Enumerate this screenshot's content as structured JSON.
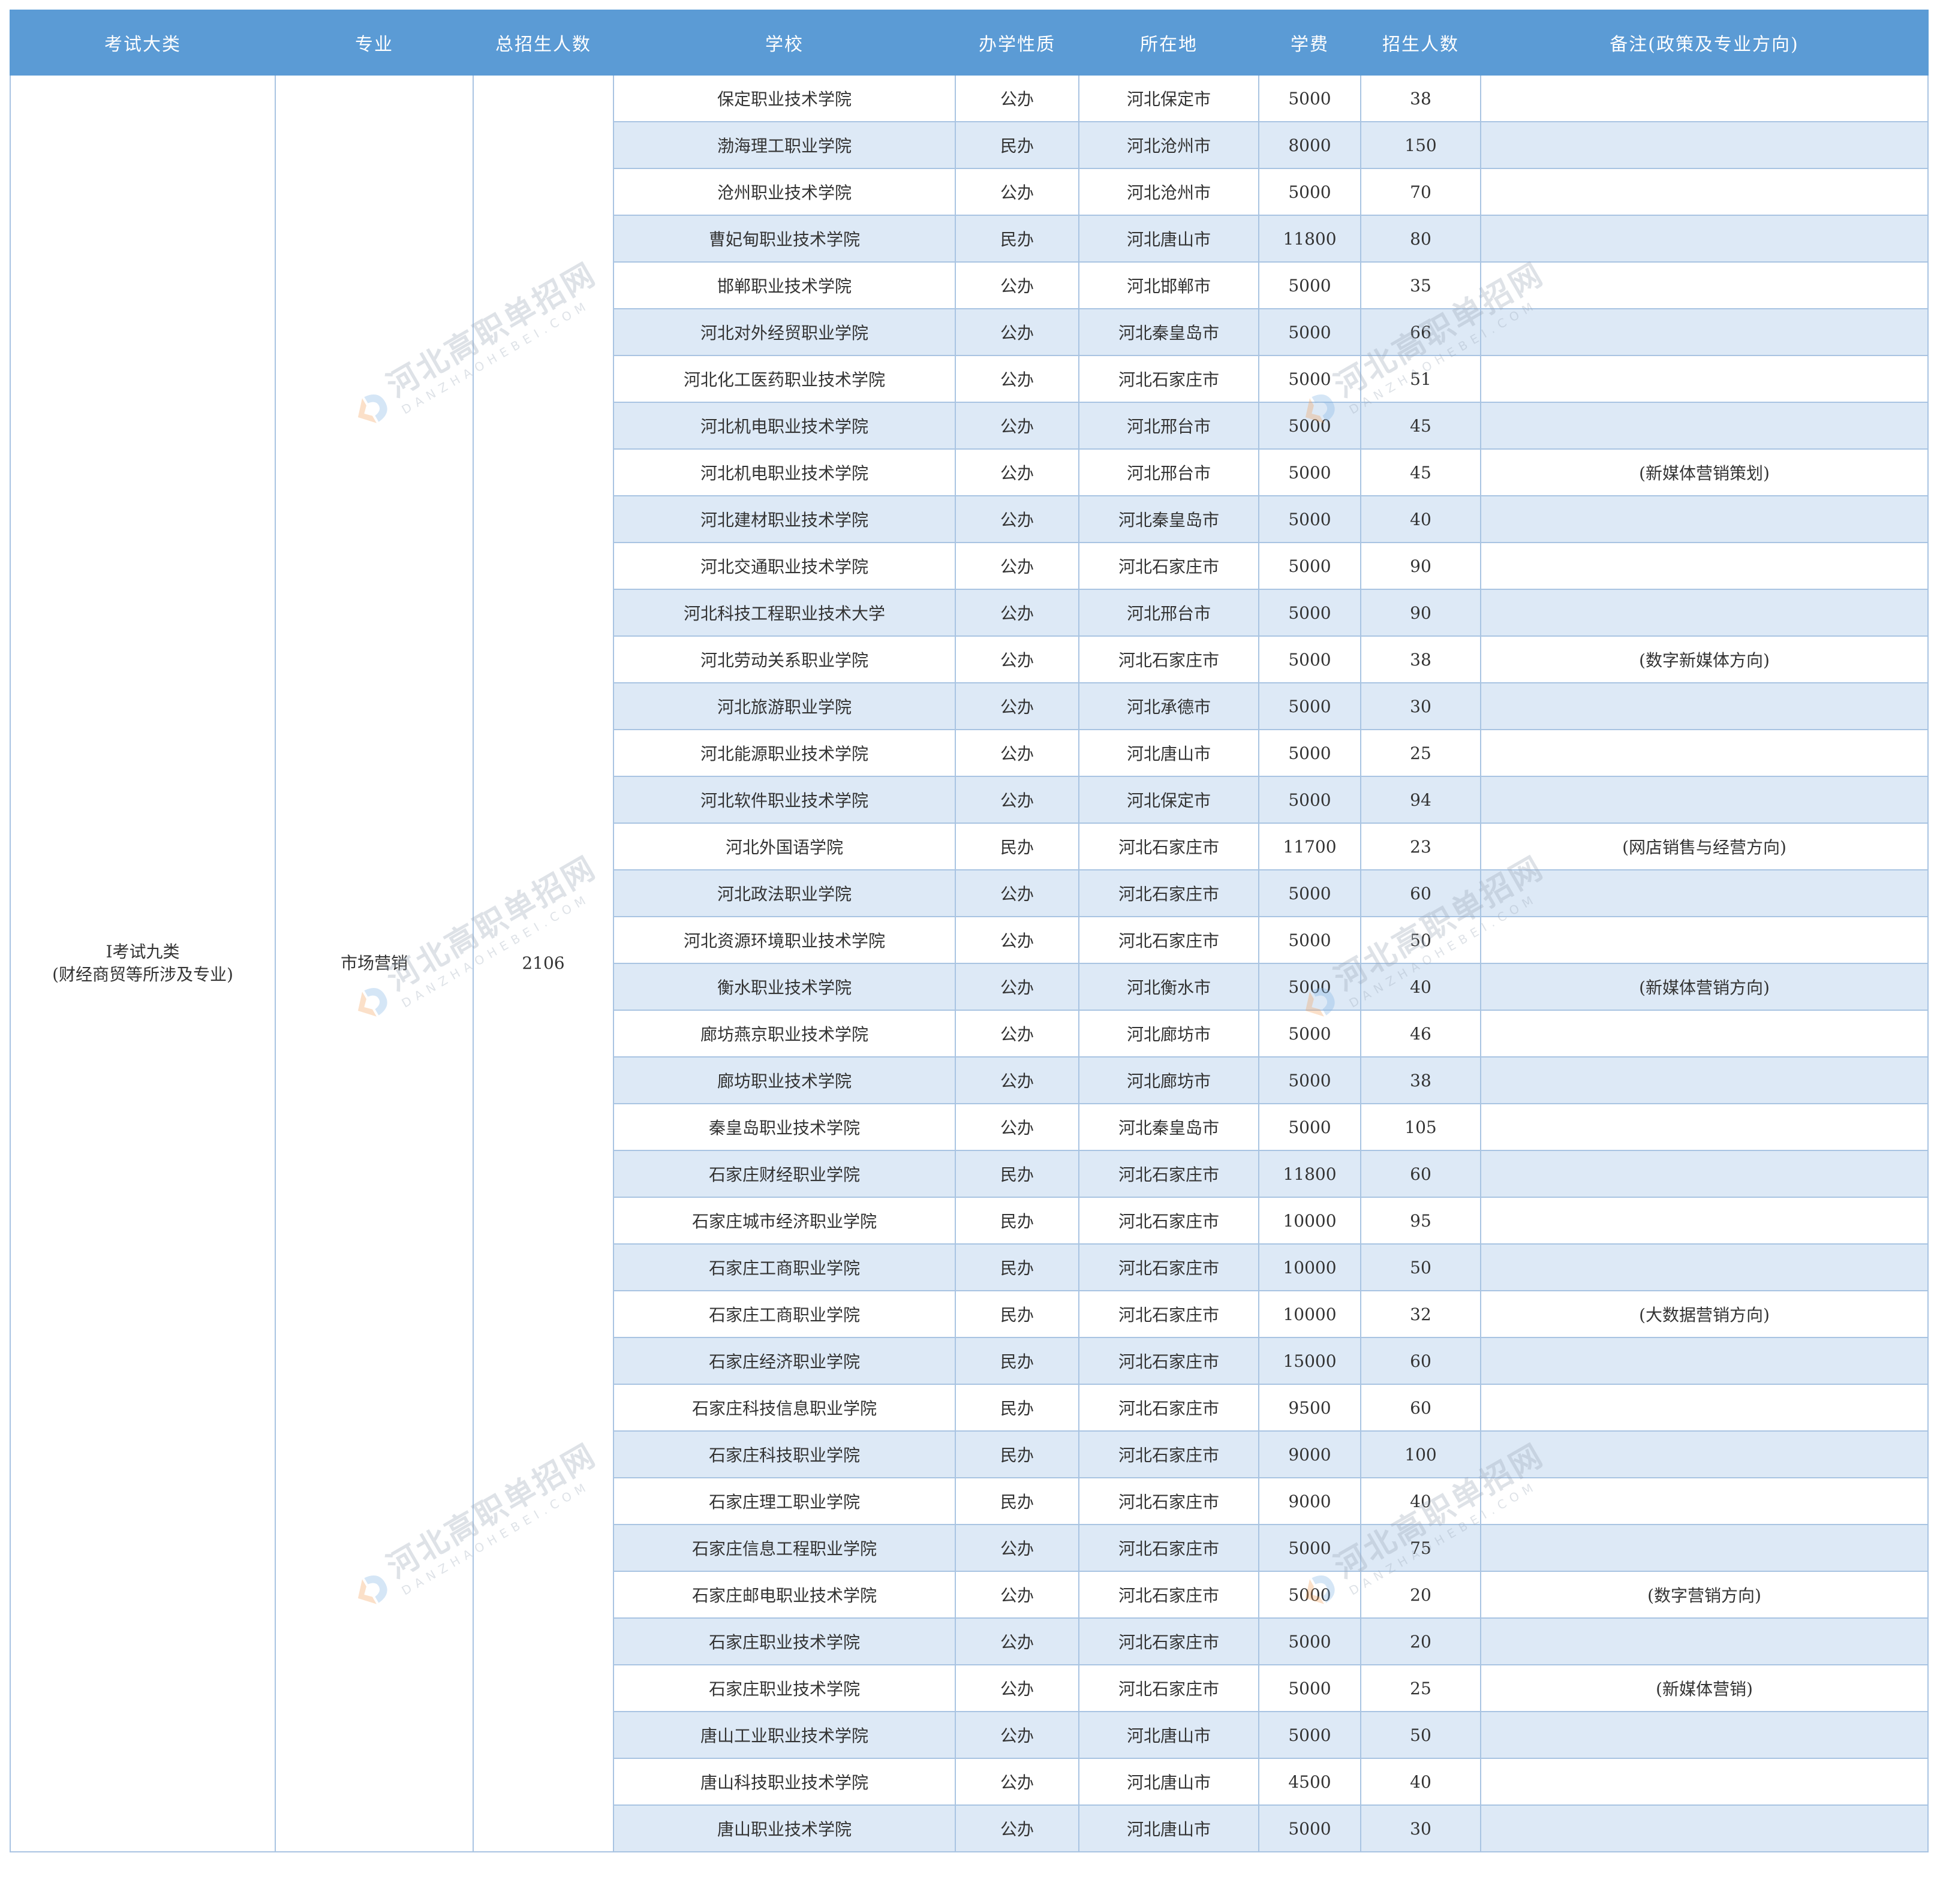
{
  "table": {
    "headers": [
      "考试大类",
      "专业",
      "总招生人数",
      "学校",
      "办学性质",
      "所在地",
      "学费",
      "招生人数",
      "备注(政策及专业方向)"
    ],
    "category_line1": "Ⅰ考试九类",
    "category_line2": "(财经商贸等所涉及专业)",
    "major": "市场营销",
    "total": "2106",
    "rows": [
      {
        "school": "保定职业技术学院",
        "nature": "公办",
        "location": "河北保定市",
        "fee": "5000",
        "count": "38",
        "note": ""
      },
      {
        "school": "渤海理工职业学院",
        "nature": "民办",
        "location": "河北沧州市",
        "fee": "8000",
        "count": "150",
        "note": ""
      },
      {
        "school": "沧州职业技术学院",
        "nature": "公办",
        "location": "河北沧州市",
        "fee": "5000",
        "count": "70",
        "note": ""
      },
      {
        "school": "曹妃甸职业技术学院",
        "nature": "民办",
        "location": "河北唐山市",
        "fee": "11800",
        "count": "80",
        "note": ""
      },
      {
        "school": "邯郸职业技术学院",
        "nature": "公办",
        "location": "河北邯郸市",
        "fee": "5000",
        "count": "35",
        "note": ""
      },
      {
        "school": "河北对外经贸职业学院",
        "nature": "公办",
        "location": "河北秦皇岛市",
        "fee": "5000",
        "count": "66",
        "note": ""
      },
      {
        "school": "河北化工医药职业技术学院",
        "nature": "公办",
        "location": "河北石家庄市",
        "fee": "5000",
        "count": "51",
        "note": ""
      },
      {
        "school": "河北机电职业技术学院",
        "nature": "公办",
        "location": "河北邢台市",
        "fee": "5000",
        "count": "45",
        "note": ""
      },
      {
        "school": "河北机电职业技术学院",
        "nature": "公办",
        "location": "河北邢台市",
        "fee": "5000",
        "count": "45",
        "note": "(新媒体营销策划)"
      },
      {
        "school": "河北建材职业技术学院",
        "nature": "公办",
        "location": "河北秦皇岛市",
        "fee": "5000",
        "count": "40",
        "note": ""
      },
      {
        "school": "河北交通职业技术学院",
        "nature": "公办",
        "location": "河北石家庄市",
        "fee": "5000",
        "count": "90",
        "note": ""
      },
      {
        "school": "河北科技工程职业技术大学",
        "nature": "公办",
        "location": "河北邢台市",
        "fee": "5000",
        "count": "90",
        "note": ""
      },
      {
        "school": "河北劳动关系职业学院",
        "nature": "公办",
        "location": "河北石家庄市",
        "fee": "5000",
        "count": "38",
        "note": "(数字新媒体方向)"
      },
      {
        "school": "河北旅游职业学院",
        "nature": "公办",
        "location": "河北承德市",
        "fee": "5000",
        "count": "30",
        "note": ""
      },
      {
        "school": "河北能源职业技术学院",
        "nature": "公办",
        "location": "河北唐山市",
        "fee": "5000",
        "count": "25",
        "note": ""
      },
      {
        "school": "河北软件职业技术学院",
        "nature": "公办",
        "location": "河北保定市",
        "fee": "5000",
        "count": "94",
        "note": ""
      },
      {
        "school": "河北外国语学院",
        "nature": "民办",
        "location": "河北石家庄市",
        "fee": "11700",
        "count": "23",
        "note": "(网店销售与经营方向)"
      },
      {
        "school": "河北政法职业学院",
        "nature": "公办",
        "location": "河北石家庄市",
        "fee": "5000",
        "count": "60",
        "note": ""
      },
      {
        "school": "河北资源环境职业技术学院",
        "nature": "公办",
        "location": "河北石家庄市",
        "fee": "5000",
        "count": "50",
        "note": ""
      },
      {
        "school": "衡水职业技术学院",
        "nature": "公办",
        "location": "河北衡水市",
        "fee": "5000",
        "count": "40",
        "note": "(新媒体营销方向)"
      },
      {
        "school": "廊坊燕京职业技术学院",
        "nature": "公办",
        "location": "河北廊坊市",
        "fee": "5000",
        "count": "46",
        "note": ""
      },
      {
        "school": "廊坊职业技术学院",
        "nature": "公办",
        "location": "河北廊坊市",
        "fee": "5000",
        "count": "38",
        "note": ""
      },
      {
        "school": "秦皇岛职业技术学院",
        "nature": "公办",
        "location": "河北秦皇岛市",
        "fee": "5000",
        "count": "105",
        "note": ""
      },
      {
        "school": "石家庄财经职业学院",
        "nature": "民办",
        "location": "河北石家庄市",
        "fee": "11800",
        "count": "60",
        "note": ""
      },
      {
        "school": "石家庄城市经济职业学院",
        "nature": "民办",
        "location": "河北石家庄市",
        "fee": "10000",
        "count": "95",
        "note": ""
      },
      {
        "school": "石家庄工商职业学院",
        "nature": "民办",
        "location": "河北石家庄市",
        "fee": "10000",
        "count": "50",
        "note": ""
      },
      {
        "school": "石家庄工商职业学院",
        "nature": "民办",
        "location": "河北石家庄市",
        "fee": "10000",
        "count": "32",
        "note": "(大数据营销方向)"
      },
      {
        "school": "石家庄经济职业学院",
        "nature": "民办",
        "location": "河北石家庄市",
        "fee": "15000",
        "count": "60",
        "note": ""
      },
      {
        "school": "石家庄科技信息职业学院",
        "nature": "民办",
        "location": "河北石家庄市",
        "fee": "9500",
        "count": "60",
        "note": ""
      },
      {
        "school": "石家庄科技职业学院",
        "nature": "民办",
        "location": "河北石家庄市",
        "fee": "9000",
        "count": "100",
        "note": ""
      },
      {
        "school": "石家庄理工职业学院",
        "nature": "民办",
        "location": "河北石家庄市",
        "fee": "9000",
        "count": "40",
        "note": ""
      },
      {
        "school": "石家庄信息工程职业学院",
        "nature": "公办",
        "location": "河北石家庄市",
        "fee": "5000",
        "count": "75",
        "note": ""
      },
      {
        "school": "石家庄邮电职业技术学院",
        "nature": "公办",
        "location": "河北石家庄市",
        "fee": "5000",
        "count": "20",
        "note": "(数字营销方向)"
      },
      {
        "school": "石家庄职业技术学院",
        "nature": "公办",
        "location": "河北石家庄市",
        "fee": "5000",
        "count": "20",
        "note": ""
      },
      {
        "school": "石家庄职业技术学院",
        "nature": "公办",
        "location": "河北石家庄市",
        "fee": "5000",
        "count": "25",
        "note": "(新媒体营销)"
      },
      {
        "school": "唐山工业职业技术学院",
        "nature": "公办",
        "location": "河北唐山市",
        "fee": "5000",
        "count": "50",
        "note": ""
      },
      {
        "school": "唐山科技职业技术学院",
        "nature": "公办",
        "location": "河北唐山市",
        "fee": "4500",
        "count": "40",
        "note": ""
      },
      {
        "school": "唐山职业技术学院",
        "nature": "公办",
        "location": "河北唐山市",
        "fee": "5000",
        "count": "30",
        "note": ""
      }
    ]
  },
  "watermark": {
    "cn": "河北高职单招网",
    "en": "DANZHAOHEBEI.COM",
    "logo_icon": "d-logo-icon",
    "logo_colors": [
      "#f4a259",
      "#7fb2e5"
    ]
  }
}
